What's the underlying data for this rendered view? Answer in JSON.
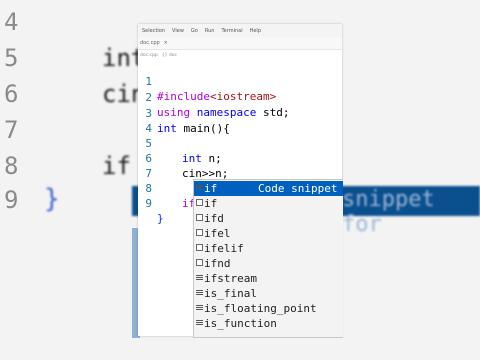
{
  "background": {
    "line_numbers": [
      "4",
      "5",
      "6",
      "7",
      "8",
      "9"
    ],
    "code_fragments": [
      "int",
      "cin",
      "if"
    ],
    "brace": "}",
    "detail_fragment": "snippet for"
  },
  "menubar": [
    "Selection",
    "View",
    "Go",
    "Run",
    "Terminal",
    "Help"
  ],
  "tab": {
    "name": "doc.cpp",
    "close": "×"
  },
  "breadcrumb": [
    "doc.cpp",
    "{} doc"
  ],
  "code": {
    "line_numbers": [
      "1",
      "2",
      "3",
      "4",
      "5",
      "6",
      "7",
      "8",
      "9"
    ],
    "l1_pp": "#include",
    "l1_header": "<iostream>",
    "l2_using": "using",
    "l2_namespace": "namespace",
    "l2_rest": " std;",
    "l3_int": "int",
    "l3_rest": " main(){",
    "l5_int": "int",
    "l5_rest": " n;",
    "l6": "cin>>n;",
    "l8": "if",
    "l9": "}"
  },
  "suggestions": [
    {
      "label": "if",
      "detail": "Code snippet for",
      "icon": "snippet-icon",
      "selected": true
    },
    {
      "label": "if",
      "icon": "snippet-icon"
    },
    {
      "label": "ifd",
      "icon": "snippet-icon"
    },
    {
      "label": "ifel",
      "icon": "snippet-icon"
    },
    {
      "label": "ifelif",
      "icon": "snippet-icon"
    },
    {
      "label": "ifnd",
      "icon": "snippet-icon"
    },
    {
      "label": "ifstream",
      "icon": "class-icon"
    },
    {
      "label": "is_final",
      "icon": "struct-icon"
    },
    {
      "label": "is_floating_point",
      "icon": "struct-icon"
    },
    {
      "label": "is_function",
      "icon": "struct-icon"
    }
  ]
}
